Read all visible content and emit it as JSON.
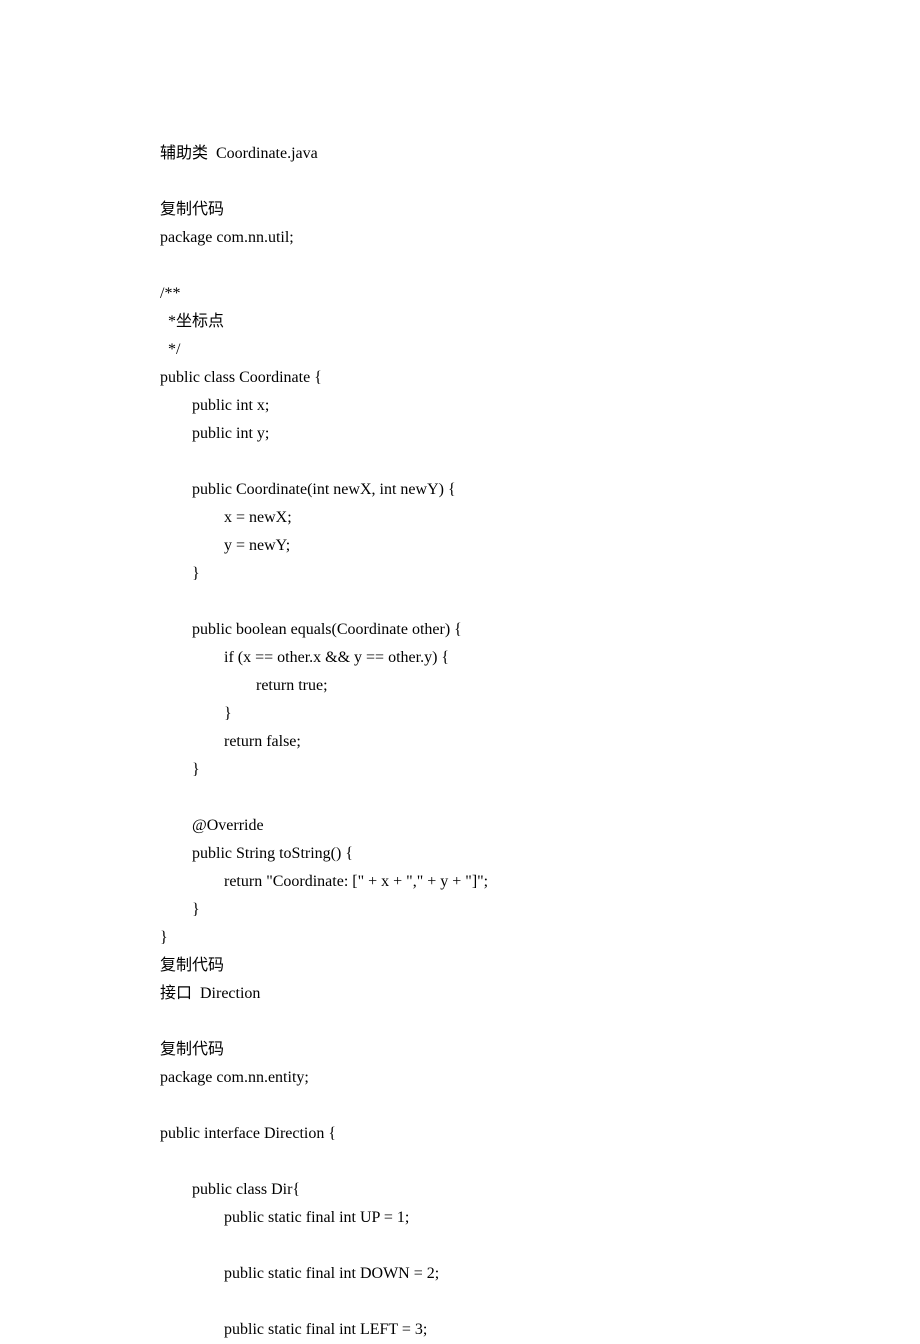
{
  "lines": [
    "辅助类  Coordinate.java",
    "",
    "复制代码",
    "package com.nn.util;",
    "",
    "/**",
    "  *坐标点",
    "  */",
    "public class Coordinate {",
    "        public int x;",
    "        public int y;",
    "",
    "        public Coordinate(int newX, int newY) {",
    "                x = newX;",
    "                y = newY;",
    "        }",
    "",
    "        public boolean equals(Coordinate other) {",
    "                if (x == other.x && y == other.y) {",
    "                        return true;",
    "                }",
    "                return false;",
    "        }",
    "",
    "        @Override",
    "        public String toString() {",
    "                return \"Coordinate: [\" + x + \",\" + y + \"]\";",
    "        }",
    "}",
    "复制代码",
    "接口  Direction",
    "",
    "复制代码",
    "package com.nn.entity;",
    "",
    "public interface Direction {",
    "",
    "        public class Dir{",
    "                public static final int UP = 1;",
    "",
    "                public static final int DOWN = 2;",
    "",
    "                public static final int LEFT = 3;"
  ]
}
